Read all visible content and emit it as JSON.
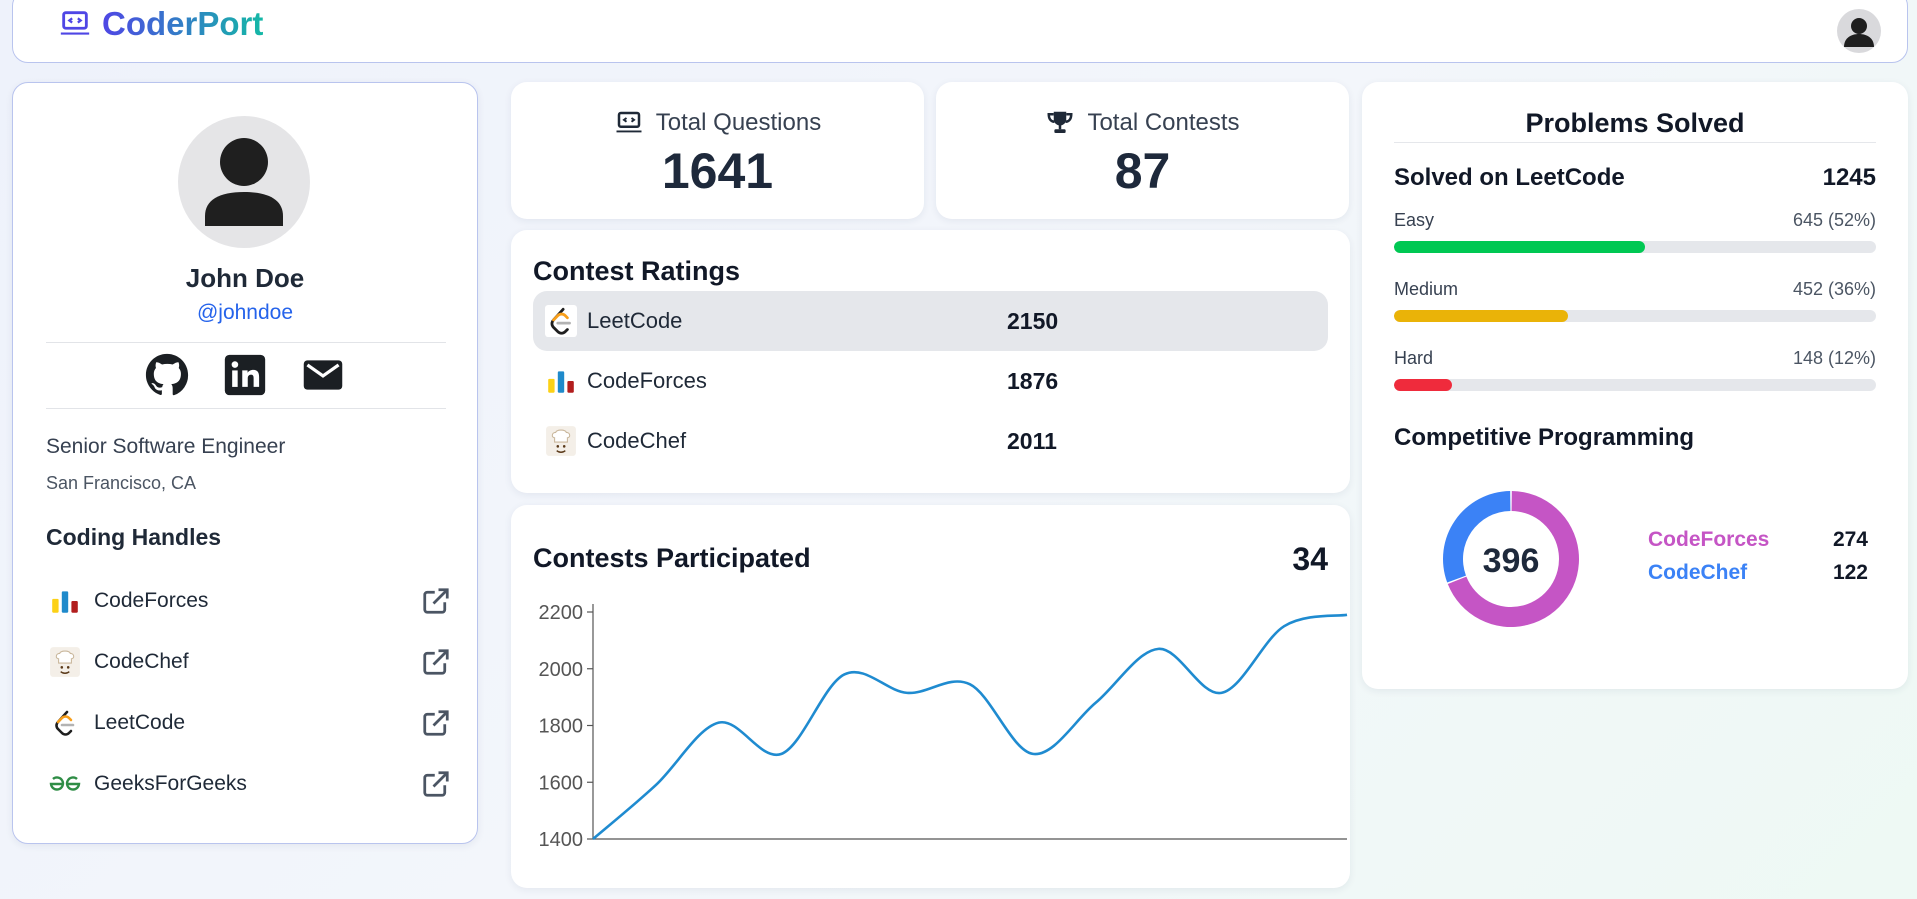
{
  "nav": {
    "brand": "CoderPort"
  },
  "profile": {
    "name": "John Doe",
    "handle": "@johndoe",
    "title": "Senior Software Engineer",
    "location": "San Francisco, CA",
    "handles_heading": "Coding Handles",
    "handles": [
      {
        "label": "CodeForces",
        "icon": "codeforces-icon"
      },
      {
        "label": "CodeChef",
        "icon": "codechef-icon"
      },
      {
        "label": "LeetCode",
        "icon": "leetcode-icon"
      },
      {
        "label": "GeeksForGeeks",
        "icon": "geeksforgeeks-icon"
      }
    ]
  },
  "stats": {
    "questions": {
      "label": "Total Questions",
      "value": "1641"
    },
    "contests": {
      "label": "Total Contests",
      "value": "87"
    }
  },
  "ratings": {
    "title": "Contest Ratings",
    "rows": [
      {
        "platform": "LeetCode",
        "rating": "2150"
      },
      {
        "platform": "CodeForces",
        "rating": "1876"
      },
      {
        "platform": "CodeChef",
        "rating": "2011"
      }
    ]
  },
  "contests": {
    "title": "Contests Participated",
    "count": "34"
  },
  "chart_data": {
    "type": "line",
    "title": "",
    "xlabel": "",
    "ylabel": "",
    "x": [
      1,
      2,
      3,
      4,
      5,
      6,
      7,
      8,
      9,
      10,
      11,
      12,
      13
    ],
    "series": [
      {
        "values": [
          1400,
          1590,
          1810,
          1700,
          1980,
          1915,
          1945,
          1700,
          1880,
          2070,
          1915,
          2150,
          2190
        ]
      }
    ],
    "ylim": [
      1400,
      2200
    ],
    "yticks": [
      2200,
      2000,
      1800,
      1600,
      1400
    ],
    "grid": false,
    "color": "#1f8bd0"
  },
  "problems": {
    "title": "Problems Solved",
    "leetcode_label": "Solved on LeetCode",
    "leetcode_total": "1245",
    "difficulty": [
      {
        "label": "Easy",
        "value": "645 (52%)",
        "fraction": 0.52,
        "color": "#00c853"
      },
      {
        "label": "Medium",
        "value": "452 (36%)",
        "fraction": 0.36,
        "color": "#eab308"
      },
      {
        "label": "Hard",
        "value": "148 (12%)",
        "fraction": 0.12,
        "color": "#ef2b3c"
      }
    ],
    "cp_title": "Competitive Programming",
    "cp_total": "396",
    "cp": [
      {
        "label": "CodeForces",
        "value": "274",
        "count": 274,
        "color": "#c555c5"
      },
      {
        "label": "CodeChef",
        "value": "122",
        "count": 122,
        "color": "#3b82f6"
      }
    ]
  }
}
